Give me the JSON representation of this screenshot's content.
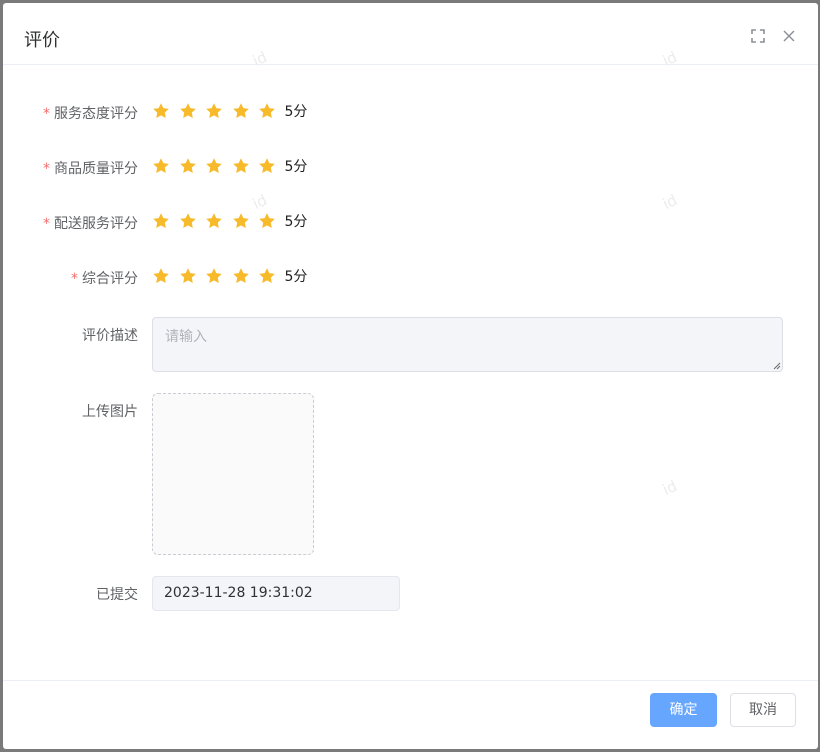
{
  "dialog": {
    "title": "评价",
    "maximize_icon": "fullscreen-icon",
    "close_icon": "close-icon"
  },
  "watermark": "id",
  "ratings": [
    {
      "label": "服务态度评分",
      "required": "*",
      "value": 5,
      "max": 5,
      "score_text": "5分"
    },
    {
      "label": "商品质量评分",
      "required": "*",
      "value": 5,
      "max": 5,
      "score_text": "5分"
    },
    {
      "label": "配送服务评分",
      "required": "*",
      "value": 5,
      "max": 5,
      "score_text": "5分"
    },
    {
      "label": "综合评分",
      "required": "*",
      "value": 5,
      "max": 5,
      "score_text": "5分"
    }
  ],
  "description": {
    "label": "评价描述",
    "placeholder": "请输入",
    "value": ""
  },
  "upload": {
    "label": "上传图片"
  },
  "submitted": {
    "label": "已提交",
    "value": "2023-11-28 19:31:02"
  },
  "footer": {
    "confirm_label": "确定",
    "cancel_label": "取消"
  },
  "colors": {
    "star": "#f7ba2a",
    "required": "#f56c6c",
    "primary": "#66a6ff"
  }
}
